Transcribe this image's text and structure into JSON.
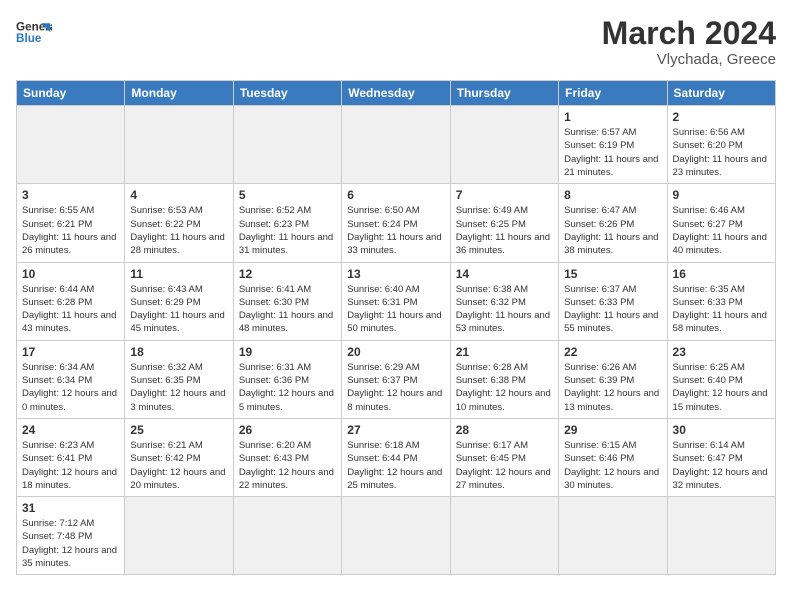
{
  "header": {
    "logo_general": "General",
    "logo_blue": "Blue",
    "title": "March 2024",
    "subtitle": "Vlychada, Greece"
  },
  "days_of_week": [
    "Sunday",
    "Monday",
    "Tuesday",
    "Wednesday",
    "Thursday",
    "Friday",
    "Saturday"
  ],
  "weeks": [
    [
      {
        "day": "",
        "info": ""
      },
      {
        "day": "",
        "info": ""
      },
      {
        "day": "",
        "info": ""
      },
      {
        "day": "",
        "info": ""
      },
      {
        "day": "",
        "info": ""
      },
      {
        "day": "1",
        "info": "Sunrise: 6:57 AM\nSunset: 6:19 PM\nDaylight: 11 hours\nand 21 minutes."
      },
      {
        "day": "2",
        "info": "Sunrise: 6:56 AM\nSunset: 6:20 PM\nDaylight: 11 hours\nand 23 minutes."
      }
    ],
    [
      {
        "day": "3",
        "info": "Sunrise: 6:55 AM\nSunset: 6:21 PM\nDaylight: 11 hours\nand 26 minutes."
      },
      {
        "day": "4",
        "info": "Sunrise: 6:53 AM\nSunset: 6:22 PM\nDaylight: 11 hours\nand 28 minutes."
      },
      {
        "day": "5",
        "info": "Sunrise: 6:52 AM\nSunset: 6:23 PM\nDaylight: 11 hours\nand 31 minutes."
      },
      {
        "day": "6",
        "info": "Sunrise: 6:50 AM\nSunset: 6:24 PM\nDaylight: 11 hours\nand 33 minutes."
      },
      {
        "day": "7",
        "info": "Sunrise: 6:49 AM\nSunset: 6:25 PM\nDaylight: 11 hours\nand 36 minutes."
      },
      {
        "day": "8",
        "info": "Sunrise: 6:47 AM\nSunset: 6:26 PM\nDaylight: 11 hours\nand 38 minutes."
      },
      {
        "day": "9",
        "info": "Sunrise: 6:46 AM\nSunset: 6:27 PM\nDaylight: 11 hours\nand 40 minutes."
      }
    ],
    [
      {
        "day": "10",
        "info": "Sunrise: 6:44 AM\nSunset: 6:28 PM\nDaylight: 11 hours\nand 43 minutes."
      },
      {
        "day": "11",
        "info": "Sunrise: 6:43 AM\nSunset: 6:29 PM\nDaylight: 11 hours\nand 45 minutes."
      },
      {
        "day": "12",
        "info": "Sunrise: 6:41 AM\nSunset: 6:30 PM\nDaylight: 11 hours\nand 48 minutes."
      },
      {
        "day": "13",
        "info": "Sunrise: 6:40 AM\nSunset: 6:31 PM\nDaylight: 11 hours\nand 50 minutes."
      },
      {
        "day": "14",
        "info": "Sunrise: 6:38 AM\nSunset: 6:32 PM\nDaylight: 11 hours\nand 53 minutes."
      },
      {
        "day": "15",
        "info": "Sunrise: 6:37 AM\nSunset: 6:33 PM\nDaylight: 11 hours\nand 55 minutes."
      },
      {
        "day": "16",
        "info": "Sunrise: 6:35 AM\nSunset: 6:33 PM\nDaylight: 11 hours\nand 58 minutes."
      }
    ],
    [
      {
        "day": "17",
        "info": "Sunrise: 6:34 AM\nSunset: 6:34 PM\nDaylight: 12 hours\nand 0 minutes."
      },
      {
        "day": "18",
        "info": "Sunrise: 6:32 AM\nSunset: 6:35 PM\nDaylight: 12 hours\nand 3 minutes."
      },
      {
        "day": "19",
        "info": "Sunrise: 6:31 AM\nSunset: 6:36 PM\nDaylight: 12 hours\nand 5 minutes."
      },
      {
        "day": "20",
        "info": "Sunrise: 6:29 AM\nSunset: 6:37 PM\nDaylight: 12 hours\nand 8 minutes."
      },
      {
        "day": "21",
        "info": "Sunrise: 6:28 AM\nSunset: 6:38 PM\nDaylight: 12 hours\nand 10 minutes."
      },
      {
        "day": "22",
        "info": "Sunrise: 6:26 AM\nSunset: 6:39 PM\nDaylight: 12 hours\nand 13 minutes."
      },
      {
        "day": "23",
        "info": "Sunrise: 6:25 AM\nSunset: 6:40 PM\nDaylight: 12 hours\nand 15 minutes."
      }
    ],
    [
      {
        "day": "24",
        "info": "Sunrise: 6:23 AM\nSunset: 6:41 PM\nDaylight: 12 hours\nand 18 minutes."
      },
      {
        "day": "25",
        "info": "Sunrise: 6:21 AM\nSunset: 6:42 PM\nDaylight: 12 hours\nand 20 minutes."
      },
      {
        "day": "26",
        "info": "Sunrise: 6:20 AM\nSunset: 6:43 PM\nDaylight: 12 hours\nand 22 minutes."
      },
      {
        "day": "27",
        "info": "Sunrise: 6:18 AM\nSunset: 6:44 PM\nDaylight: 12 hours\nand 25 minutes."
      },
      {
        "day": "28",
        "info": "Sunrise: 6:17 AM\nSunset: 6:45 PM\nDaylight: 12 hours\nand 27 minutes."
      },
      {
        "day": "29",
        "info": "Sunrise: 6:15 AM\nSunset: 6:46 PM\nDaylight: 12 hours\nand 30 minutes."
      },
      {
        "day": "30",
        "info": "Sunrise: 6:14 AM\nSunset: 6:47 PM\nDaylight: 12 hours\nand 32 minutes."
      }
    ],
    [
      {
        "day": "31",
        "info": "Sunrise: 7:12 AM\nSunset: 7:48 PM\nDaylight: 12 hours\nand 35 minutes."
      },
      {
        "day": "",
        "info": ""
      },
      {
        "day": "",
        "info": ""
      },
      {
        "day": "",
        "info": ""
      },
      {
        "day": "",
        "info": ""
      },
      {
        "day": "",
        "info": ""
      },
      {
        "day": "",
        "info": ""
      }
    ]
  ]
}
